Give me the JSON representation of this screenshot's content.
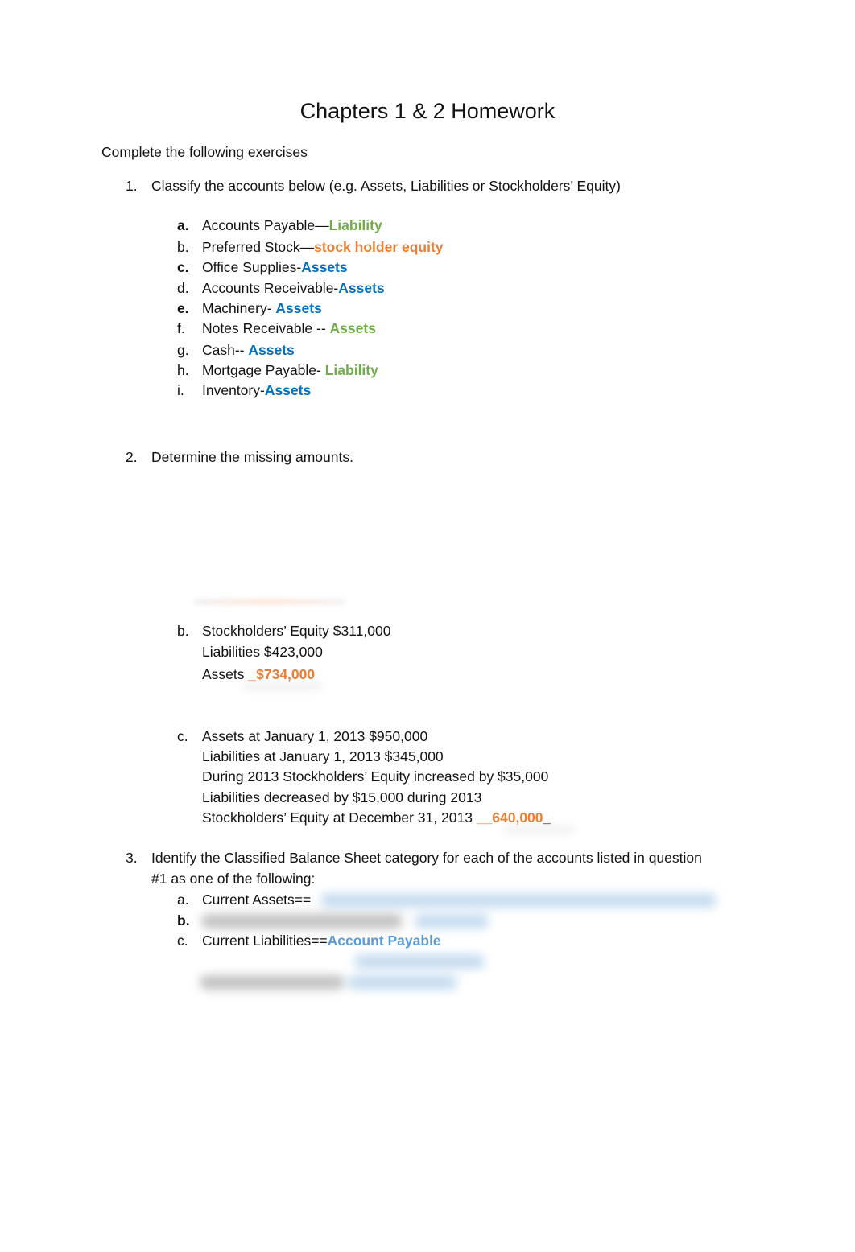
{
  "document": {
    "title": "Chapters 1 & 2 Homework",
    "intro": "Complete the following exercises"
  },
  "q1": {
    "number": "1.",
    "prompt": "Classify the accounts below  (e.g. Assets, Liabilities or Stockholders’ Equity)",
    "items": [
      {
        "label": "a.",
        "account": "Accounts Payable—",
        "answer": "Liability",
        "answer_color": "#70ad47"
      },
      {
        "label": "b.",
        "account": "Preferred Stock—",
        "answer": "stock holder equity",
        "answer_color": "#ed7d31"
      },
      {
        "label": "c.",
        "account": "Office Supplies-",
        "answer": "Assets",
        "answer_color": "#0070c0"
      },
      {
        "label": "d.",
        "account": "Accounts Receivable-",
        "answer": "Assets",
        "answer_color": "#0070c0"
      },
      {
        "label": "e.",
        "account": "Machinery- ",
        "answer": "Assets",
        "answer_color": "#0070c0"
      },
      {
        "label": "f.",
        "account": "Notes Receivable -- ",
        "answer": "Assets",
        "answer_color": "#70ad47"
      },
      {
        "label": "g.",
        "account": "Cash-- ",
        "answer": "Assets",
        "answer_color": "#0070c0"
      },
      {
        "label": "h.",
        "account": "Mortgage Payable- ",
        "answer": "Liability",
        "answer_color": "#70ad47"
      },
      {
        "label": "i.",
        "account": "Inventory-",
        "answer": "Assets",
        "answer_color": "#0070c0"
      }
    ]
  },
  "q2": {
    "number": "2.",
    "prompt": "Determine the missing amounts.",
    "b": {
      "label": "b.",
      "lines": [
        "Stockholders’ Equity $311,000",
        "Liabilities $423,000"
      ],
      "assets_prefix": "Assets ",
      "assets_answer": "_$734,000"
    },
    "c": {
      "label": "c.",
      "lines": [
        "Assets at January 1, 2013 $950,000",
        "Liabilities at January 1, 2013 $345,000",
        "During 2013 Stockholders’ Equity increased by $35,000",
        "Liabilities decreased by $15,000 during 2013"
      ],
      "equity_prefix": "Stockholders’ Equity at December 31, 2013 ",
      "equity_answer": "__640,000",
      "equity_suffix": "_"
    }
  },
  "q3": {
    "number": "3.",
    "prompt_line1": "Identify the Classified Balance Sheet category for each of the accounts listed in question",
    "prompt_line2": "#1 as one of the following:",
    "items": [
      {
        "label": "a.",
        "text": "Current Assets==",
        "answer": ""
      },
      {
        "label": "b.",
        "text": "",
        "answer": ""
      },
      {
        "label": "c.",
        "text": "Current Liabilities==",
        "answer": "Account Payable"
      }
    ]
  }
}
